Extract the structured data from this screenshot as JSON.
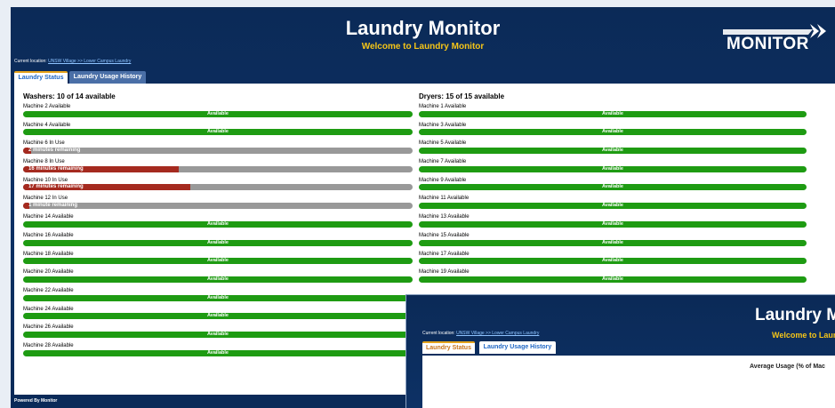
{
  "colors": {
    "available": "#1e9b12",
    "in_use_fill": "#a52a1f",
    "in_use_track": "#999999",
    "accent": "#f5c518"
  },
  "header": {
    "title": "Laundry Monitor",
    "subtitle": "Welcome to Laundry Monitor",
    "logo_text": "MONITOR",
    "logo_icon": "chevron-arrows-icon"
  },
  "location": {
    "label": "Current location:",
    "link": "UNSW Village >> Lower Campus Laundry"
  },
  "tabs": [
    {
      "label": "Laundry Status"
    },
    {
      "label": "Laundry Usage History"
    }
  ],
  "washers": {
    "heading": "Washers: 10 of 14 available",
    "machines": [
      {
        "label": "Machine 2 Available",
        "status": "available",
        "bar_text": "Available"
      },
      {
        "label": "Machine 4 Available",
        "status": "available",
        "bar_text": "Available"
      },
      {
        "label": "Machine 6 In Use",
        "status": "in_use",
        "bar_text": "2 minutes remaining",
        "progress": 0.02
      },
      {
        "label": "Machine 8 In Use",
        "status": "in_use",
        "bar_text": "16 minutes remaining",
        "progress": 0.4
      },
      {
        "label": "Machine 10 In Use",
        "status": "in_use",
        "bar_text": "17 minutes remaining",
        "progress": 0.43
      },
      {
        "label": "Machine 12 In Use",
        "status": "in_use",
        "bar_text": "1 minute remaining",
        "progress": 0.01
      },
      {
        "label": "Machine 14 Available",
        "status": "available",
        "bar_text": "Available"
      },
      {
        "label": "Machine 16 Available",
        "status": "available",
        "bar_text": "Available"
      },
      {
        "label": "Machine 18 Available",
        "status": "available",
        "bar_text": "Available"
      },
      {
        "label": "Machine 20 Available",
        "status": "available",
        "bar_text": "Available"
      },
      {
        "label": "Machine 22 Available",
        "status": "available",
        "bar_text": "Available"
      },
      {
        "label": "Machine 24 Available",
        "status": "available",
        "bar_text": "Available"
      },
      {
        "label": "Machine 26 Available",
        "status": "available",
        "bar_text": "Available"
      },
      {
        "label": "Machine 28 Available",
        "status": "available",
        "bar_text": "Available"
      }
    ]
  },
  "dryers": {
    "heading": "Dryers: 15 of 15 available",
    "machines": [
      {
        "label": "Machine 1 Available",
        "status": "available",
        "bar_text": "Available"
      },
      {
        "label": "Machine 3 Available",
        "status": "available",
        "bar_text": "Available"
      },
      {
        "label": "Machine 5 Available",
        "status": "available",
        "bar_text": "Available"
      },
      {
        "label": "Machine 7 Available",
        "status": "available",
        "bar_text": "Available"
      },
      {
        "label": "Machine 9 Available",
        "status": "available",
        "bar_text": "Available"
      },
      {
        "label": "Machine 11 Available",
        "status": "available",
        "bar_text": "Available"
      },
      {
        "label": "Machine 13 Available",
        "status": "available",
        "bar_text": "Available"
      },
      {
        "label": "Machine 15 Available",
        "status": "available",
        "bar_text": "Available"
      },
      {
        "label": "Machine 17 Available",
        "status": "available",
        "bar_text": "Available"
      },
      {
        "label": "Machine 19 Available",
        "status": "available",
        "bar_text": "Available"
      }
    ]
  },
  "footer": {
    "text": "Powered By Monitor"
  },
  "second_window": {
    "title": "Laundry M",
    "subtitle": "Welcome to Laun",
    "location_label": "Current location:",
    "location_link": "UNSW Village >> Lower Campus Laundry",
    "tabs": [
      {
        "label": "Laundry Status"
      },
      {
        "label": "Laundry Usage History"
      }
    ],
    "chart_title": "Average Usage (% of Mac"
  }
}
